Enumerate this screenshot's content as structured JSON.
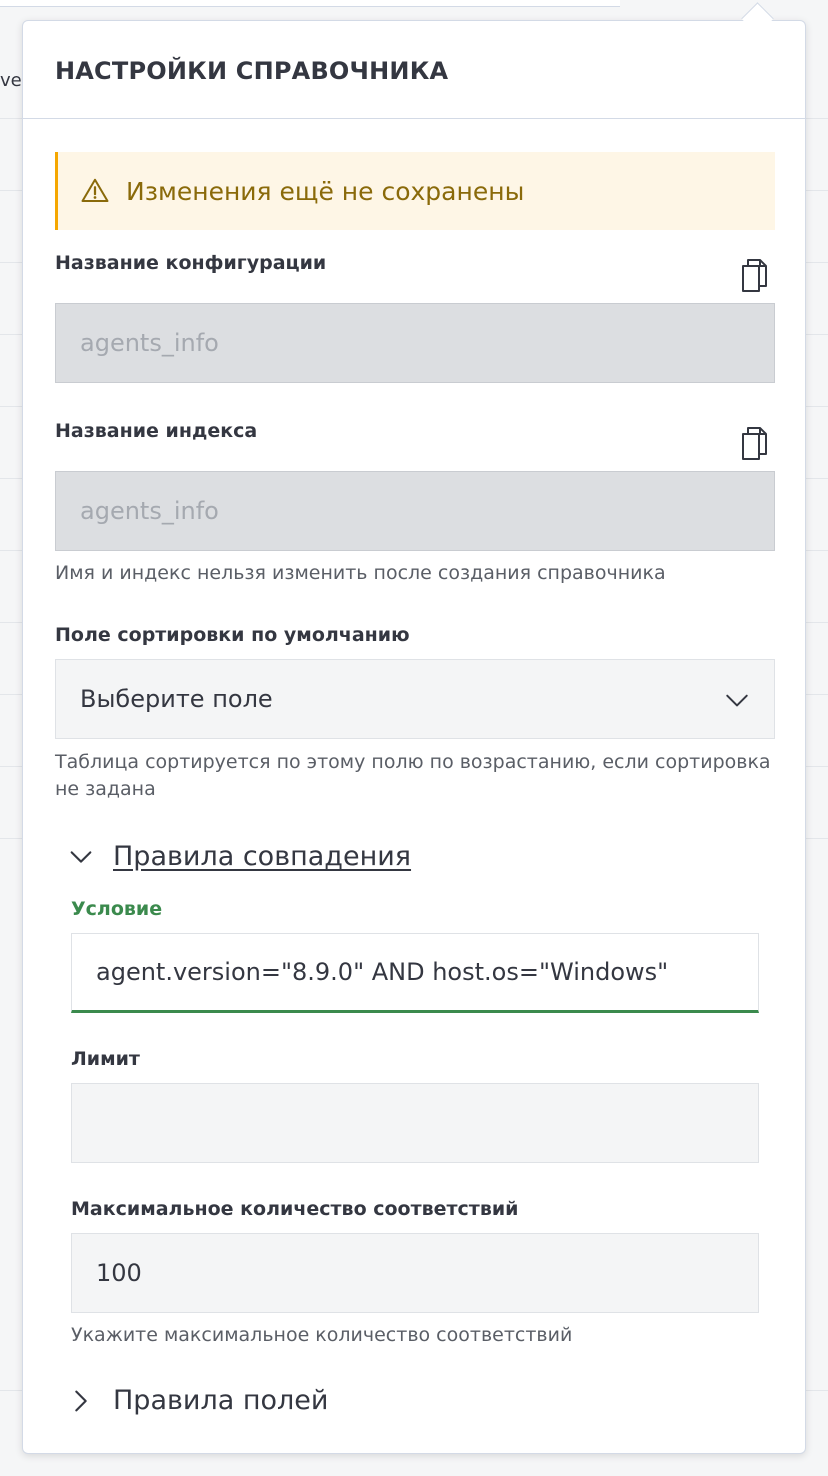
{
  "background": {
    "clipped_text": "ver"
  },
  "panel": {
    "title": "НАСТРОЙКИ СПРАВОЧНИКА",
    "callout": {
      "icon": "warning-triangle-icon",
      "text": "Изменения ещё не сохранены"
    },
    "config_name": {
      "label": "Название конфигурации",
      "value": "agents_info",
      "copy_icon": "copy-icon"
    },
    "index_name": {
      "label": "Название индекса",
      "value": "agents_info",
      "copy_icon": "copy-icon"
    },
    "name_index_help": "Имя и индекс нельзя изменить после создания справочника",
    "sort_field": {
      "label": "Поле сортировки по умолчанию",
      "selected": "Выберите поле",
      "help": "Таблица сортируется по этому полю по возрастанию, если сортировка не задана"
    },
    "match_rules": {
      "title": "Правила совпадения",
      "expanded": true,
      "condition": {
        "label": "Условие",
        "value": "agent.version=\"8.9.0\" AND host.os=\"Windows\""
      },
      "limit": {
        "label": "Лимит",
        "value": ""
      },
      "max_matches": {
        "label": "Максимальное количество соответствий",
        "value": "100",
        "help": "Укажите максимальное количество соответствий"
      }
    },
    "field_rules": {
      "title": "Правила полей",
      "expanded": false
    }
  },
  "colors": {
    "callout_bg": "#fef6e6",
    "callout_border": "#f5a700",
    "callout_text": "#8a6a0a",
    "condition_label": "#3b8a4d",
    "active_underline": "#3b8a4d"
  }
}
